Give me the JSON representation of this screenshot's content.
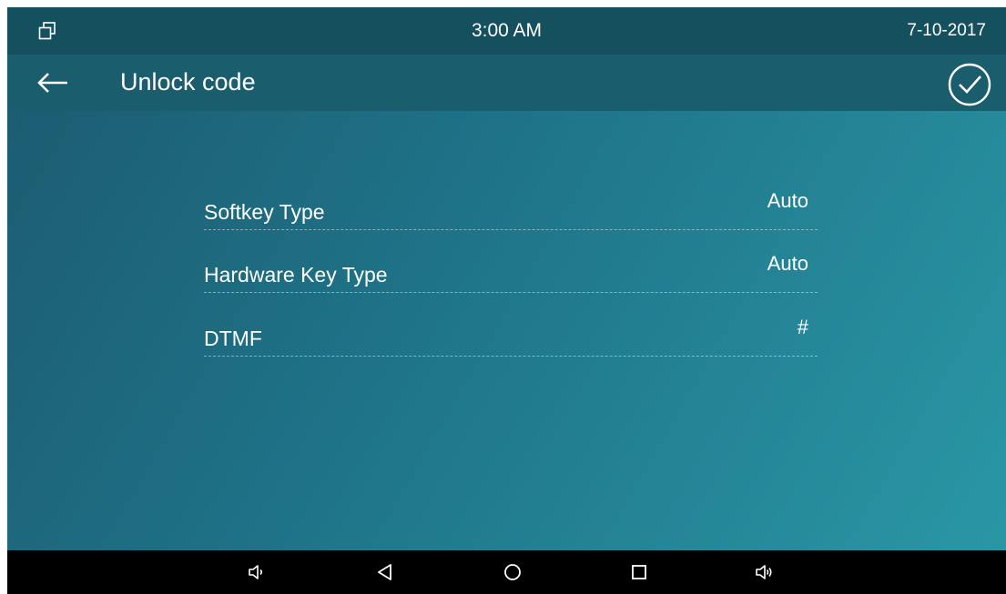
{
  "status_bar": {
    "time": "3:00 AM",
    "date": "7-10-2017",
    "icons": {
      "left": "multi-window-icon"
    }
  },
  "title_bar": {
    "title": "Unlock code",
    "icons": {
      "back": "back-arrow-icon",
      "confirm": "check-circle-icon"
    }
  },
  "settings": {
    "rows": [
      {
        "label": "Softkey Type",
        "value": "Auto"
      },
      {
        "label": "Hardware Key Type",
        "value": "Auto"
      },
      {
        "label": "DTMF",
        "value": "#"
      }
    ]
  },
  "nav_bar": {
    "icons": [
      "volume-down-icon",
      "back-triangle-icon",
      "home-circle-icon",
      "recents-square-icon",
      "volume-up-icon"
    ]
  },
  "colors": {
    "status_bar": "#15505f",
    "title_bar": "#1a5d6d",
    "gradient_start": "#1c5a6f",
    "gradient_end": "#2a98a6",
    "text": "#ffffff",
    "nav_bar": "#000000"
  }
}
